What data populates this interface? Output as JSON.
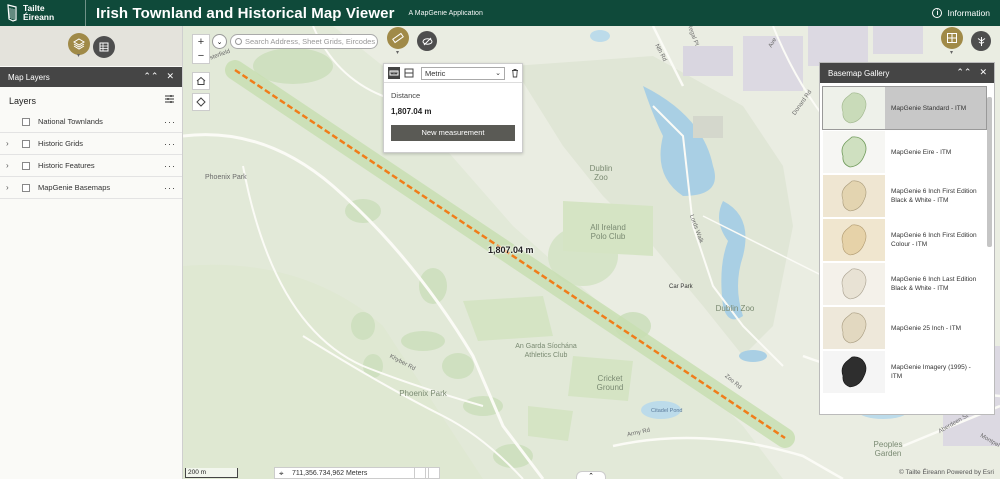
{
  "header": {
    "org_line1": "Tailte",
    "org_line2": "Éireann",
    "title": "Irish Townland and Historical Map Viewer",
    "subtitle": "A MapGenie Application",
    "info_label": "Information",
    "info_icon": "i"
  },
  "colors": {
    "header_bg": "#0f4a3a",
    "tool_gold": "#a08a48",
    "tool_gray": "#4e4e4e",
    "measure_line": "#f07d1a",
    "panel_head": "#454545"
  },
  "layers_panel": {
    "title": "Map Layers",
    "collapse_icon": "⌃⌃",
    "close_icon": "✕",
    "section_title": "Layers",
    "items": [
      {
        "label": "National Townlands",
        "expandable": false
      },
      {
        "label": "Historic Grids",
        "expandable": true
      },
      {
        "label": "Historic Features",
        "expandable": true
      },
      {
        "label": "MapGenie Basemaps",
        "expandable": true
      }
    ],
    "expand_icon": "›",
    "menu_icon": "···"
  },
  "map": {
    "zoom_in": "+",
    "zoom_out": "−",
    "search_placeholder": "Search Address, Sheet Grids, Eircodes",
    "search_dropdown_icon": "⌄",
    "distance_label": "1,807.04 m",
    "labels": {
      "phoenix_park_1": "Phoenix Park",
      "phoenix_park_2": "Phoenix Park",
      "dublin_zoo_1": "Dublin\nZoo",
      "dublin_zoo_2": "Dublin Zoo",
      "all_ireland_polo": "All Ireland\nPolo Club",
      "garda_athletics": "An Garda Síochána\nAthletics Club",
      "cricket_ground": "Cricket\nGround",
      "peoples_garden": "Peoples\nGarden",
      "car_park": "Car Park",
      "khyber_rd": "Khyber Rd",
      "zoo_rd": "Zoo Rd",
      "army_rd": "Army Rd",
      "lords_walk": "Lords Walk",
      "nth_rd": "Nth Rd",
      "regal_pl": "Regal Pl",
      "aberdeen_st": "Aberdeen St",
      "montpelier": "Montpel",
      "donard_rd": "Donard Rd",
      "chesterfield": "Chesterfield",
      "citadel_pond": "Citadel Pond",
      "road_ave": "Ave"
    }
  },
  "measurement": {
    "unit_selected": "Metric",
    "distance_label": "Distance",
    "distance_value": "1,807.04 m",
    "new_button": "New measurement"
  },
  "basemap_gallery": {
    "title": "Basemap Gallery",
    "collapse_icon": "⌃⌃",
    "close_icon": "✕",
    "items": [
      {
        "name": "MapGenie Standard - ITM",
        "selected": true,
        "thumb": "standard"
      },
      {
        "name": "MapGenie Eire - ITM",
        "selected": false,
        "thumb": "eire"
      },
      {
        "name": "MapGenie 6 Inch First Edition Black & White - ITM",
        "selected": false,
        "thumb": "sixinch-bw"
      },
      {
        "name": "MapGenie 6 Inch First Edition Colour - ITM",
        "selected": false,
        "thumb": "sixinch-colour"
      },
      {
        "name": "MapGenie 6 Inch Last Edition Black & White - ITM",
        "selected": false,
        "thumb": "sixinch-last"
      },
      {
        "name": "MapGenie 25 Inch - ITM",
        "selected": false,
        "thumb": "twentyfive"
      },
      {
        "name": "MapGenie Imagery (1995) - ITM",
        "selected": false,
        "thumb": "imagery"
      }
    ]
  },
  "footer": {
    "scale_label": "200 m",
    "coordinates": "711,356.734,962 Meters",
    "attribution": "© Tailte Éireann   Powered by Esri",
    "tab_icon": "⌃"
  }
}
